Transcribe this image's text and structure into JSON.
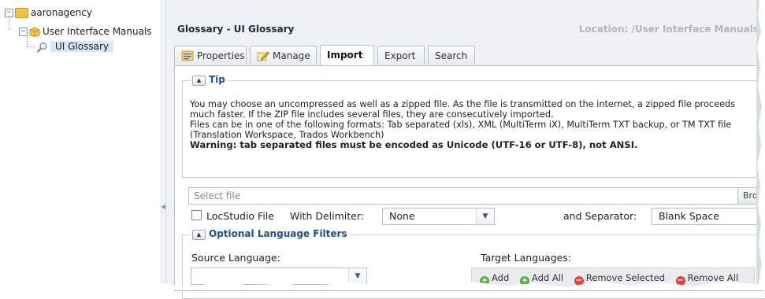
{
  "tree": {
    "root": "aaronagency",
    "child": "User Interface Manuals",
    "leaf": "UI Glossary"
  },
  "header": {
    "title": "Glossary - UI Glossary",
    "location": "Location: /User Interface Manuals"
  },
  "tabs": [
    {
      "label": "Properties",
      "icon": "properties-icon"
    },
    {
      "label": "Manage",
      "icon": "manage-icon"
    },
    {
      "label": "Import"
    },
    {
      "label": "Export"
    },
    {
      "label": "Search"
    }
  ],
  "tip": {
    "legend": "Tip",
    "line1": "You may choose an uncompressed as well as a zipped file. As the file is transmitted on the internet, a zipped file proceeds much faster. If the ZIP file includes several files, they are consecutively imported.",
    "line2": "Files can be in one of the following formats: Tab separated (xls), XML (MultiTerm iX), MultiTerm TXT backup, or TM TXT file (Translation Workspace, Trados Workbench)",
    "warning": "Warning: tab separated files must be encoded as Unicode (UTF-16 or UTF-8), not ANSI."
  },
  "file": {
    "placeholder": "Select file",
    "browse_label": "Browse..."
  },
  "options": {
    "locstudio_label": "LocStudio File",
    "delimiter_label": "With Delimiter:",
    "delimiter_value": "None",
    "separator_label": "and Separator:",
    "separator_value": "Blank Space"
  },
  "filters": {
    "legend": "Optional Language Filters",
    "source_label": "Source Language:",
    "source_value": "",
    "target_label": "Target Languages:",
    "toolbar": {
      "add": "Add",
      "add_all": "Add All",
      "remove_selected": "Remove Selected",
      "remove_all": "Remove All"
    }
  },
  "colors": {
    "accent": "#1e4f8e",
    "location": "#b5b5b5",
    "selection": "#d7e7f7"
  }
}
